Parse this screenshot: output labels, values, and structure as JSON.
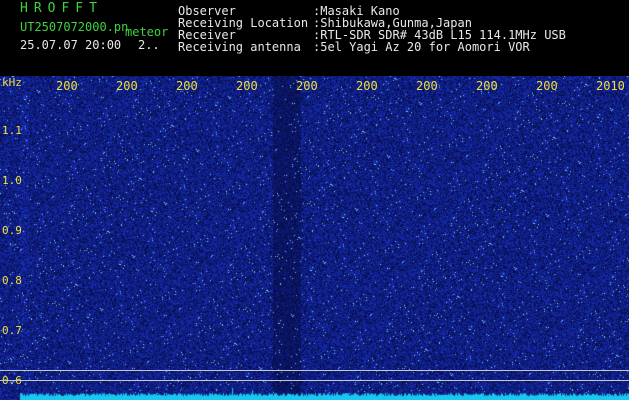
{
  "header": {
    "app_title": "HROFFT",
    "filename": "UT2507072000.pn",
    "meteor_label": "meteor",
    "datetime": "25.07.07 20:00",
    "extra": "2..",
    "info": [
      {
        "label": "Observer",
        "value": ":Masaki Kano"
      },
      {
        "label": "Receiving Location",
        "value": ":Shibukawa,Gunma,Japan"
      },
      {
        "label": "Receiver",
        "value": ":RTL-SDR SDR# 43dB L15 114.1MHz USB"
      },
      {
        "label": "Receiving antenna",
        "value": ":5el Yagi Az 20 for Aomori VOR"
      }
    ]
  },
  "plot": {
    "y_unit": "kHz",
    "y_ticks": [
      "1.1",
      "1.0",
      "0.9",
      "0.8",
      "0.7",
      "0.6"
    ],
    "x_ticks": [
      "200",
      "200",
      "200",
      "200",
      "200",
      "200",
      "200",
      "200",
      "200",
      "2010"
    ],
    "colors": {
      "background": "#0a0f4a",
      "noise": "#2a3cc8",
      "labels": "#f0e040",
      "spectrum": "#18c8f0"
    }
  }
}
